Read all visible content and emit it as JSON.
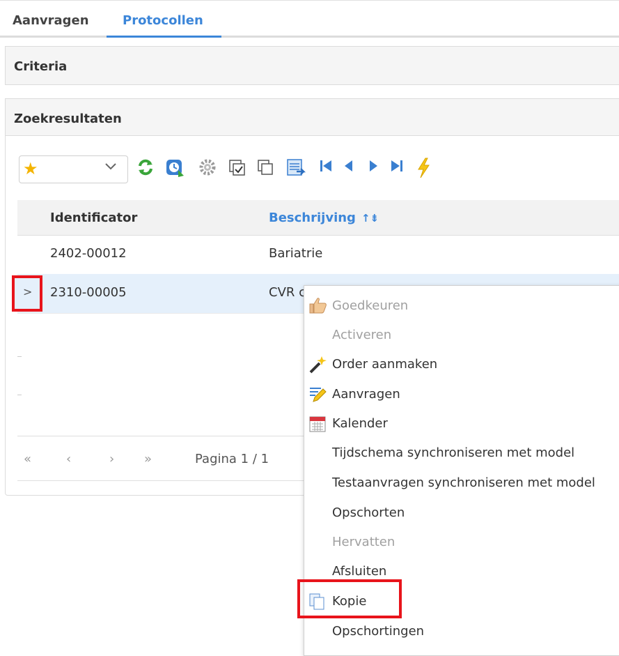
{
  "tabs": [
    {
      "label": "Aanvragen",
      "active": false
    },
    {
      "label": "Protocollen",
      "active": true
    }
  ],
  "panels": {
    "criteria_title": "Criteria",
    "results_title": "Zoekresultaten"
  },
  "toolbar": {
    "favorites_icon": "star-icon",
    "icons": [
      "refresh-icon",
      "schedule-icon",
      "settings-icon",
      "select-all-icon",
      "copy-icon",
      "export-icon",
      "first-page-icon",
      "previous-page-icon",
      "next-page-icon",
      "last-page-icon",
      "lightning-icon"
    ]
  },
  "grid": {
    "columns": {
      "identificator": "Identificator",
      "beschrijving": "Beschrijving"
    },
    "rows": [
      {
        "identificator": "2402-00012",
        "beschrijving": "Bariatrie"
      },
      {
        "identificator": "2310-00005",
        "beschrijving": "CVR c"
      }
    ],
    "expander_glyph": ">"
  },
  "pager": {
    "first": "«",
    "prev": "‹",
    "next": "›",
    "last": "»",
    "text": "Pagina 1 / 1"
  },
  "context_menu": {
    "items": [
      {
        "label": "Goedkeuren",
        "icon": "thumbs-up-icon",
        "disabled": true
      },
      {
        "label": "Activeren",
        "icon": "",
        "disabled": true
      },
      {
        "label": "Order aanmaken",
        "icon": "magic-wand-icon",
        "disabled": false
      },
      {
        "label": "Aanvragen",
        "icon": "pen-form-icon",
        "disabled": false
      },
      {
        "label": "Kalender",
        "icon": "calendar-icon",
        "disabled": false
      },
      {
        "label": "Tijdschema synchroniseren met model",
        "icon": "",
        "disabled": false
      },
      {
        "label": "Testaanvragen synchroniseren met model",
        "icon": "",
        "disabled": false
      },
      {
        "label": "Opschorten",
        "icon": "",
        "disabled": false
      },
      {
        "label": "Hervatten",
        "icon": "",
        "disabled": true
      },
      {
        "label": "Afsluiten",
        "icon": "",
        "disabled": false
      },
      {
        "label": "Kopie",
        "icon": "copy-icon",
        "disabled": false
      },
      {
        "label": "Opschortingen",
        "icon": "",
        "disabled": false
      }
    ]
  },
  "colors": {
    "accent": "#3c86d9",
    "highlight_border": "#e8141b",
    "selected_row": "#e5f0fb"
  }
}
